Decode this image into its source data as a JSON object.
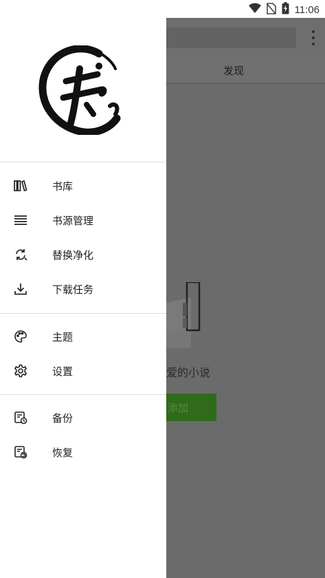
{
  "status_bar": {
    "time": "11:06"
  },
  "background": {
    "tab_label": "发现",
    "empty_text": "爱的小说",
    "add_button_label": "添加"
  },
  "drawer": {
    "groups": [
      [
        {
          "label": "书库",
          "icon": "bookshelf-icon"
        },
        {
          "label": "书源管理",
          "icon": "list-icon"
        },
        {
          "label": "替换净化",
          "icon": "replace-icon"
        },
        {
          "label": "下载任务",
          "icon": "download-icon"
        }
      ],
      [
        {
          "label": "主题",
          "icon": "palette-icon"
        },
        {
          "label": "设置",
          "icon": "gear-icon"
        }
      ],
      [
        {
          "label": "备份",
          "icon": "backup-icon"
        },
        {
          "label": "恢复",
          "icon": "restore-icon"
        }
      ]
    ]
  }
}
